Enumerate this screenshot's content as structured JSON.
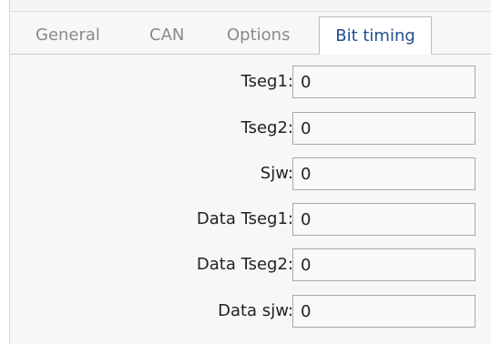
{
  "tabs": [
    {
      "label": "General",
      "active": false
    },
    {
      "label": "CAN",
      "active": false
    },
    {
      "label": "Options",
      "active": false
    },
    {
      "label": "Bit timing",
      "active": true
    }
  ],
  "fields": [
    {
      "label": "Tseg1:",
      "value": "0"
    },
    {
      "label": "Tseg2:",
      "value": "0"
    },
    {
      "label": "Sjw:",
      "value": "0"
    },
    {
      "label": "Data Tseg1:",
      "value": "0"
    },
    {
      "label": "Data Tseg2:",
      "value": "0"
    },
    {
      "label": "Data sjw:",
      "value": "0"
    }
  ],
  "colors": {
    "active_tab_text": "#1f4f8f",
    "inactive_tab_text": "#8a8a8a",
    "panel_background": "#f7f7f7",
    "input_border": "#a9a9a9"
  }
}
